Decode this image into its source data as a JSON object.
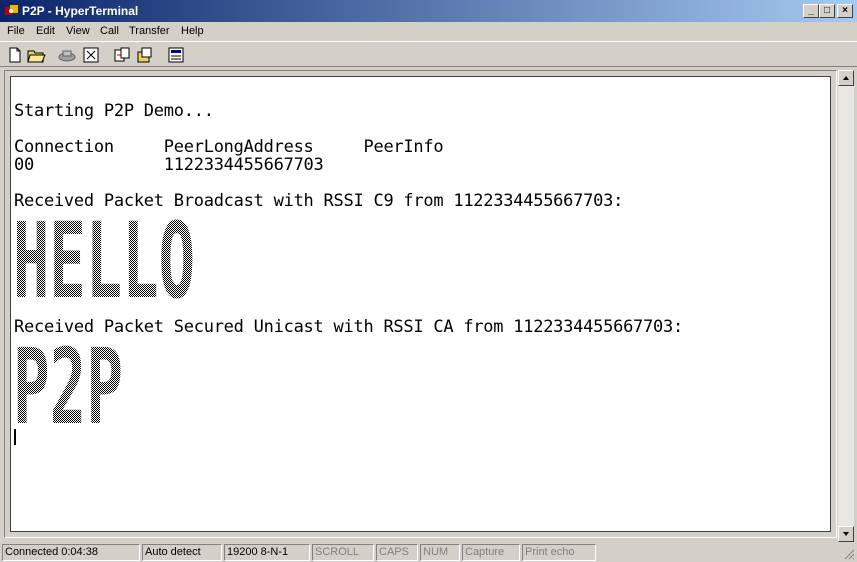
{
  "window": {
    "title": "P2P - HyperTerminal",
    "controls": {
      "minimize": "_",
      "maximize": "□",
      "close": "×"
    }
  },
  "menu": [
    "File",
    "Edit",
    "View",
    "Call",
    "Transfer",
    "Help"
  ],
  "toolbar": {
    "buttons": [
      "new-icon",
      "open-icon",
      "disconnect-icon",
      "dial-icon",
      "send-icon",
      "receive-icon",
      "properties-icon"
    ]
  },
  "terminal": {
    "lines": [
      "Starting P2P Demo...",
      "Connection     PeerLongAddress     PeerInfo",
      "00             1122334455667703",
      "Received Packet Broadcast with RSSI C9 from 1122334455667703:",
      "Received Packet Secured Unicast with RSSI CA from 1122334455667703:"
    ],
    "art_1": "HELLO",
    "art_2": "P2P"
  },
  "statusbar": {
    "connected": "Connected 0:04:38",
    "detect": "Auto detect",
    "settings": "19200 8-N-1",
    "scroll": "SCROLL",
    "caps": "CAPS",
    "num": "NUM",
    "capture": "Capture",
    "print_echo": "Print echo"
  },
  "colors": {
    "titlebar_start": "#0a246a",
    "titlebar_end": "#a6caf0",
    "chrome": "#d4d0c8",
    "terminal_bg": "#ffffff"
  }
}
